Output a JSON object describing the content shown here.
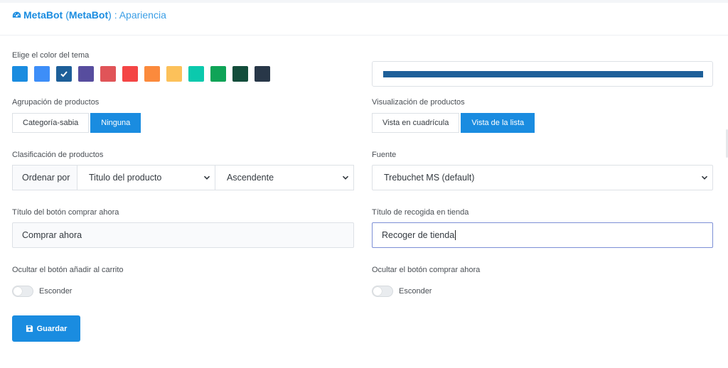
{
  "header": {
    "title_part1": "MetaBot",
    "title_part2": "( ",
    "title_part3": "MetaBot",
    "title_part4": " )",
    "title_part5": " : Apariencia",
    "icon": "dashboard-gauge-icon"
  },
  "theme": {
    "label": "Elige el color del tema",
    "colors": [
      "#1a8ce0",
      "#3d8ef8",
      "#1d5f99",
      "#574d9e",
      "#e05458",
      "#f44545",
      "#fb8a3c",
      "#fcc15a",
      "#0bc9ad",
      "#0fa457",
      "#134d3b",
      "#283748"
    ],
    "selected_index": 2,
    "selected_color": "#1d5f99",
    "check_icon": "check-icon"
  },
  "grouping": {
    "label": "Agrupación de productos",
    "options": [
      "Categoría-sabia",
      "Ninguna"
    ],
    "selected": "Ninguna"
  },
  "display": {
    "label": "Visualización de productos",
    "options": [
      "Vista en cuadrícula",
      "Vista de la lista"
    ],
    "selected": "Vista de la lista"
  },
  "sorting": {
    "label": "Clasificación de productos",
    "prefix": "Ordenar por",
    "field_value": "Titulo del producto",
    "order_value": "Ascendente"
  },
  "font": {
    "label": "Fuente",
    "value": "Trebuchet MS (default)"
  },
  "buy_now": {
    "label": "Título del botón comprar ahora",
    "value": "Comprar ahora"
  },
  "pickup": {
    "label": "Título de recogida en tienda",
    "value": "Recoger de tienda"
  },
  "hide_cart": {
    "label": "Ocultar el botón añadir al carrito",
    "toggle_label": "Esconder",
    "enabled": false
  },
  "hide_buy": {
    "label": "Ocultar el botón comprar ahora",
    "toggle_label": "Esconder",
    "enabled": false
  },
  "save": {
    "label": "Guardar",
    "icon": "save-floppy-icon"
  }
}
